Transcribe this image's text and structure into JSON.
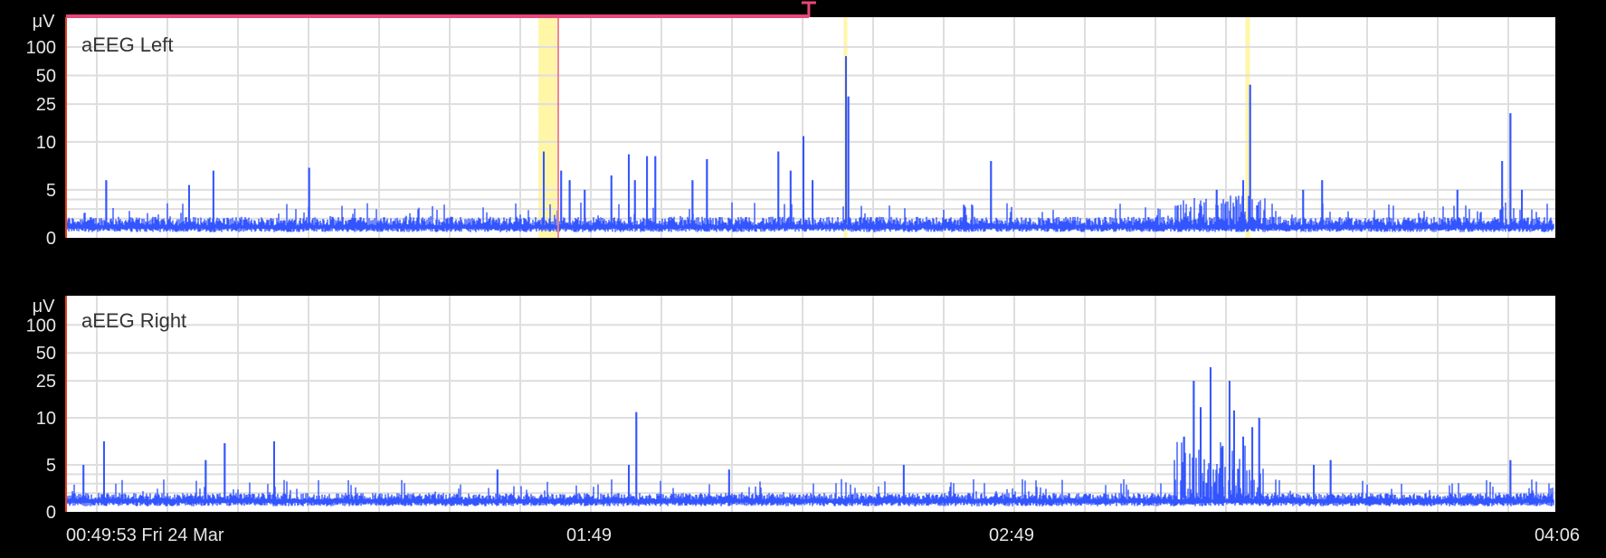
{
  "chart_data": [
    {
      "type": "line",
      "title": "aEEG Left",
      "ylabel": "μV",
      "y_ticks": [
        "100",
        "50",
        "25",
        "10",
        "5",
        "0"
      ],
      "y_tick_values": [
        100,
        50,
        25,
        10,
        5,
        0
      ],
      "y_scale": "linear 0-10, logarithmic 10-100",
      "ylim": [
        0,
        100
      ],
      "xlim_minutes": [
        0,
        196.1
      ],
      "baseline_range": [
        0.6,
        2.2
      ],
      "elevated_regions": [
        {
          "from": 146,
          "to": 158,
          "level": 3
        }
      ],
      "spikes": [
        [
          5.3,
          6
        ],
        [
          16.2,
          5.5
        ],
        [
          19.4,
          7
        ],
        [
          32,
          7.3
        ],
        [
          62.9,
          9
        ],
        [
          65.2,
          7
        ],
        [
          66.3,
          6
        ],
        [
          68.3,
          5
        ],
        [
          71.8,
          6.5
        ],
        [
          74.1,
          8.7
        ],
        [
          74.9,
          6
        ],
        [
          76.5,
          8.5
        ],
        [
          77.6,
          8.5
        ],
        [
          82.5,
          6
        ],
        [
          84.4,
          8.2
        ],
        [
          93.8,
          9
        ],
        [
          95.4,
          7
        ],
        [
          97.1,
          11.5
        ],
        [
          98.3,
          6
        ],
        [
          102.7,
          80
        ],
        [
          103,
          30
        ],
        [
          121.8,
          8
        ],
        [
          151.5,
          5
        ],
        [
          155,
          6
        ],
        [
          155.9,
          40
        ],
        [
          162.9,
          5
        ],
        [
          165.4,
          6
        ],
        [
          183.2,
          5
        ],
        [
          189.1,
          8
        ],
        [
          190.2,
          20
        ],
        [
          191.7,
          5
        ]
      ],
      "markers": {
        "yellow_bands_minutes": [
          [
            62.2,
            64.6
          ],
          [
            102.4,
            102.8
          ],
          [
            155.3,
            155.9
          ]
        ],
        "red_line_minutes": 64.8,
        "top_bar_end_minutes": 97.8
      },
      "colors": {
        "trace": "#3355ff",
        "grid": "#dddddd",
        "band": "#fff6a8",
        "marker": "#e8477a"
      }
    },
    {
      "type": "line",
      "title": "aEEG Right",
      "ylabel": "μV",
      "y_ticks": [
        "100",
        "50",
        "25",
        "10",
        "5",
        "0"
      ],
      "y_tick_values": [
        100,
        50,
        25,
        10,
        5,
        0
      ],
      "y_scale": "linear 0-10, logarithmic 10-100",
      "ylim": [
        0,
        100
      ],
      "xlim_minutes": [
        0,
        196.1
      ],
      "baseline_range": [
        0.6,
        2.0
      ],
      "elevated_regions": [
        {
          "from": 146,
          "to": 158,
          "level": 6
        }
      ],
      "spikes": [
        [
          2.3,
          5
        ],
        [
          5,
          7.5
        ],
        [
          18.4,
          5.5
        ],
        [
          20.9,
          7.3
        ],
        [
          27.4,
          7.5
        ],
        [
          56.8,
          4.5
        ],
        [
          74.1,
          5
        ],
        [
          75.1,
          11.5
        ],
        [
          87.3,
          4.5
        ],
        [
          110.3,
          5
        ],
        [
          147.2,
          8
        ],
        [
          148.5,
          25
        ],
        [
          149.4,
          13
        ],
        [
          150.7,
          35
        ],
        [
          152.3,
          7
        ],
        [
          153.2,
          25
        ],
        [
          153.8,
          12
        ],
        [
          155,
          8
        ],
        [
          156.2,
          9
        ],
        [
          157.1,
          10
        ],
        [
          164.3,
          5
        ],
        [
          166.5,
          5.5
        ],
        [
          190.2,
          5.5
        ]
      ],
      "colors": {
        "trace": "#3355ff",
        "grid": "#dddddd"
      }
    }
  ],
  "x_axis": {
    "labels": [
      "00:49:53 Fri 24 Mar",
      "01:49",
      "02:49",
      "04:06"
    ],
    "label_minutes": [
      0,
      59.1,
      119.1,
      196.1
    ]
  }
}
